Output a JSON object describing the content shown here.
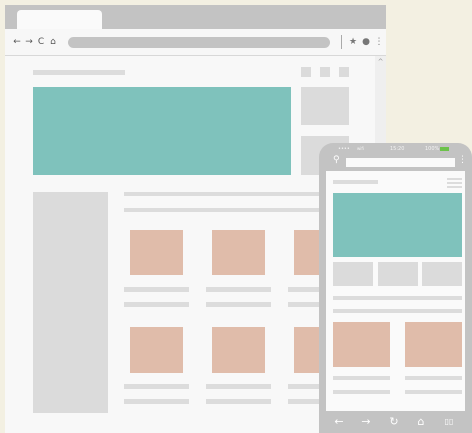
{
  "browser": {
    "nav": {
      "back": "←",
      "forward": "→",
      "reload": "C",
      "home": "⌂"
    },
    "tools": {
      "star": "★",
      "profile": "●",
      "menu": "⋮"
    },
    "scroll_up": "^"
  },
  "phone": {
    "status": {
      "signal": "••••",
      "wifi": "wifi",
      "time": "15:20",
      "battery": "100%"
    },
    "bottom_nav": {
      "back": "←",
      "forward": "→",
      "reload": "↻",
      "home": "⌂",
      "bookmarks": "▯▯"
    },
    "colors": {
      "battery": "#6cc24a"
    }
  },
  "colors": {
    "background": "#f3f0e2",
    "frame": "#c3c3c3",
    "teal": "#7fc2bc",
    "pink": "#e0bcaa",
    "placeholder": "#dcdcdc"
  }
}
